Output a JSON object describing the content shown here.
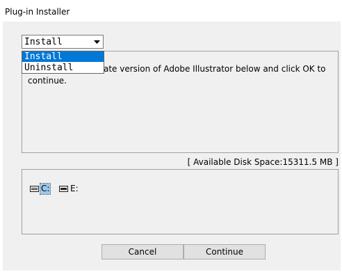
{
  "window": {
    "title": "Plug-in Installer"
  },
  "mode_select": {
    "value": "Install",
    "options": [
      "Install",
      "Uninstall"
    ],
    "highlighted_option": "Install",
    "arrow_icon": "chevron-down-icon"
  },
  "message": {
    "line1": "ate version of Adobe Illustrator below and click OK to",
    "line2": "continue."
  },
  "disk_space": {
    "label": "[ Available Disk Space:15311.5 MB ]"
  },
  "drives": [
    {
      "label": "C:",
      "selected": true,
      "icon": "drive-icon"
    },
    {
      "label": "E:",
      "selected": false,
      "icon": "drive-icon"
    }
  ],
  "buttons": {
    "cancel": "Cancel",
    "continue": "Continue"
  },
  "colors": {
    "selection": "#0078d7",
    "drive_selection": "#99c9ef",
    "dialog_background": "#f0f0f0"
  }
}
